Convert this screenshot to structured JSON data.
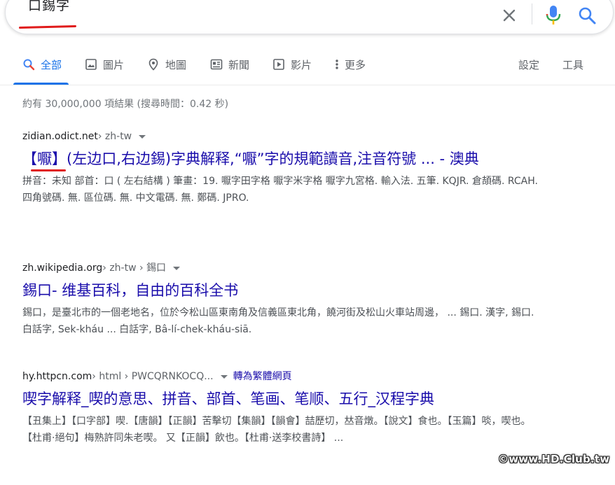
{
  "search": {
    "query": "口錫字"
  },
  "tabs": [
    {
      "label": "全部",
      "icon": "search-icon",
      "active": true
    },
    {
      "label": "圖片",
      "icon": "image-icon"
    },
    {
      "label": "地圖",
      "icon": "map-pin-icon"
    },
    {
      "label": "新聞",
      "icon": "newspaper-icon"
    },
    {
      "label": "影片",
      "icon": "play-icon"
    },
    {
      "label": "更多",
      "icon": "more-vert-icon"
    }
  ],
  "tools": {
    "settings": "設定",
    "tools": "工具"
  },
  "stats": "約有 30,000,000 項結果 (搜尋時間：0.42 秒)",
  "results": [
    {
      "site": "zidian.odict.net",
      "path": " › zh-tw",
      "title": "【嚈】(左边口,右边錫)字典解释,“嚈”字的規範讀音,注音符號 ... - 澳典",
      "snippet": "拼音：未知 部首：口 ( 左右結構 ) 筆畫：19. 嚈字田字格 嚈字米字格 嚈字九宮格. 輸入法. 五筆. KQJR. 倉頡碼. RCAH. 四角號碼. 無. 區位碼. 無. 中文電碼. 無. 鄭碼. JPRO."
    },
    {
      "site": "zh.wikipedia.org",
      "path": " › zh-tw › 錫口",
      "title": "錫口- 维基百科，自由的百科全书",
      "snippet": "錫口，是臺北市的一個老地名，位於今松山區東南角及信義區東北角，饒河街及松山火車站周邊， ... 錫口. 漢字, 錫口. 白話字, Sek-kháu ... 白話字, Bâ-lí-chek-kháu-siā."
    },
    {
      "site": "hy.httpcn.com",
      "path": " › html › PWCQRNKOCQ...",
      "translate": "轉為繁體網頁",
      "title": "喫字解释_喫的意思、拼音、部首、笔画、笔顺、五行_汉程字典",
      "snippet": "【丑集上】【口字部】喫.【唐韻】【正韻】苦擊切【集韻】【韻會】喆歷切，𠀤音燉。【說文】食也。【玉篇】啖，喫也。【杜甫·絕句】梅熟許同朱老喫。 又【正韻】飲也。【杜甫·送李校書詩】 ..."
    }
  ],
  "watermark": "©www.HD.Club.tw",
  "colors": {
    "link": "#1a0dab",
    "accent": "#1a73e8",
    "annotation": "#e01b1b"
  }
}
